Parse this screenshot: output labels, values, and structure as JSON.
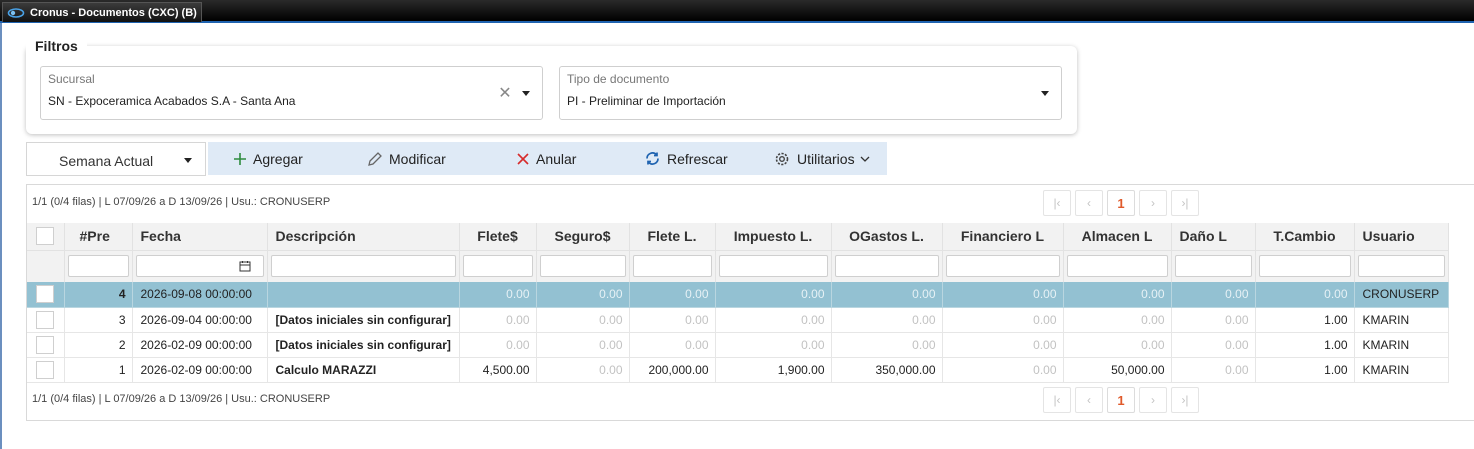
{
  "window": {
    "title": "Cronus - Documentos (CXC) (B)"
  },
  "filters": {
    "legend": "Filtros",
    "sucursal": {
      "label": "Sucursal",
      "value": "SN - Expoceramica Acabados S.A - Santa Ana"
    },
    "tipo_documento": {
      "label": "Tipo de documento",
      "value": "PI - Preliminar de Importación"
    }
  },
  "period_select": {
    "value": "Semana Actual"
  },
  "toolbar": {
    "agregar": "Agregar",
    "modificar": "Modificar",
    "anular": "Anular",
    "refrescar": "Refrescar",
    "utilitarios": "Utilitarios"
  },
  "pager": {
    "info_top": "1/1 (0/4 filas) | L 07/09/26 a D 13/09/26 | Usu.: CRONUSERP",
    "info_bottom": "1/1 (0/4 filas) | L 07/09/26 a D 13/09/26 | Usu.: CRONUSERP",
    "current_page": "1"
  },
  "table": {
    "columns": [
      "#Pre",
      "Fecha",
      "Descripción",
      "Flete$",
      "Seguro$",
      "Flete L.",
      "Impuesto L.",
      "OGastos L.",
      "Financiero L",
      "Almacen L",
      "Daño L",
      "T.Cambio",
      "Usuario"
    ],
    "rows": [
      {
        "pre": "4",
        "fecha": "2026-09-08 00:00:00",
        "descripcion": "",
        "flete_usd": "0.00",
        "seguro_usd": "0.00",
        "flete_l": "0.00",
        "impuesto_l": "0.00",
        "ogastos_l": "0.00",
        "financiero_l": "0.00",
        "almacen_l": "0.00",
        "dano_l": "0.00",
        "tcambio": "0.00",
        "usuario": "CRONUSERP"
      },
      {
        "pre": "3",
        "fecha": "2026-09-04 00:00:00",
        "descripcion": "[Datos iniciales sin configurar]",
        "flete_usd": "0.00",
        "seguro_usd": "0.00",
        "flete_l": "0.00",
        "impuesto_l": "0.00",
        "ogastos_l": "0.00",
        "financiero_l": "0.00",
        "almacen_l": "0.00",
        "dano_l": "0.00",
        "tcambio": "1.00",
        "usuario": "KMARIN"
      },
      {
        "pre": "2",
        "fecha": "2026-02-09 00:00:00",
        "descripcion": "[Datos iniciales sin configurar]",
        "flete_usd": "0.00",
        "seguro_usd": "0.00",
        "flete_l": "0.00",
        "impuesto_l": "0.00",
        "ogastos_l": "0.00",
        "financiero_l": "0.00",
        "almacen_l": "0.00",
        "dano_l": "0.00",
        "tcambio": "1.00",
        "usuario": "KMARIN"
      },
      {
        "pre": "1",
        "fecha": "2026-02-09 00:00:00",
        "descripcion": "Calculo MARAZZI",
        "flete_usd": "4,500.00",
        "seguro_usd": "0.00",
        "flete_l": "200,000.00",
        "impuesto_l": "1,900.00",
        "ogastos_l": "350,000.00",
        "financiero_l": "0.00",
        "almacen_l": "50,000.00",
        "dano_l": "0.00",
        "tcambio": "1.00",
        "usuario": "KMARIN"
      }
    ]
  },
  "colors": {
    "accent": "#1f63b0",
    "selected_row": "#93c1d2",
    "toolbar_bg": "#dfeaf6",
    "current_page": "#e05a2b"
  }
}
